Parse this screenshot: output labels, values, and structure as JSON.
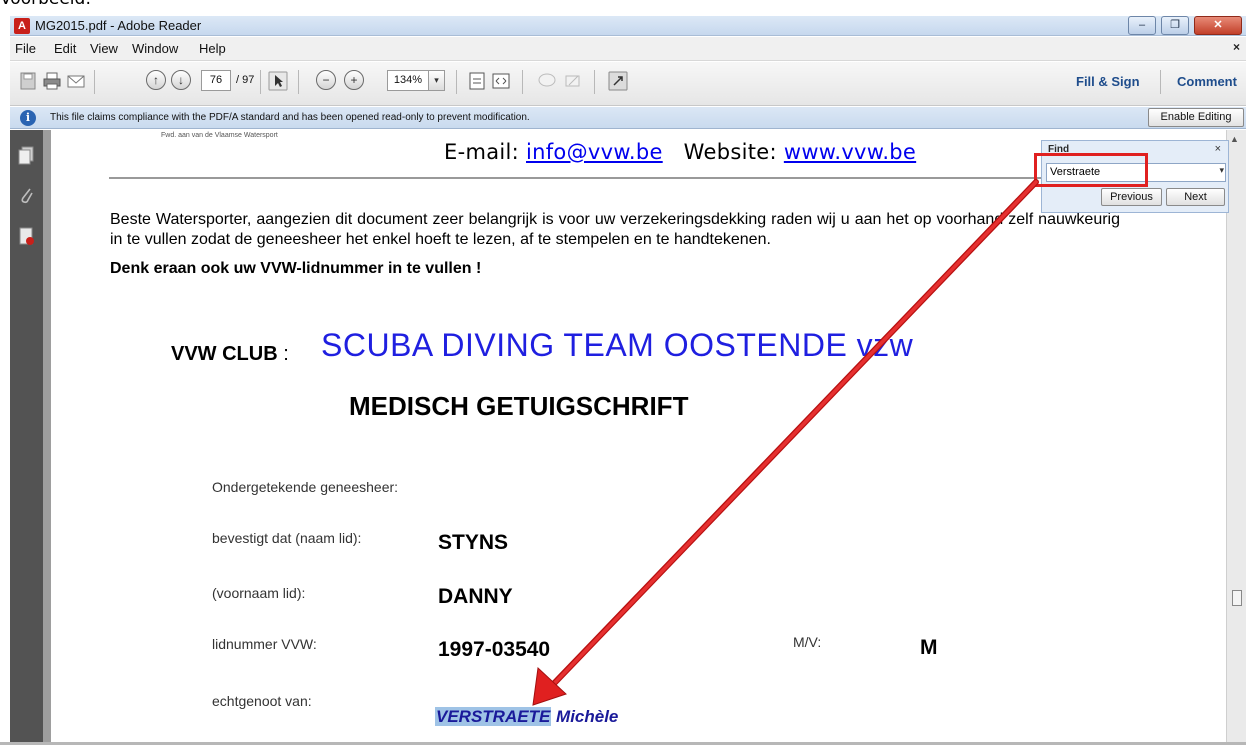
{
  "caption": "Voorbeeld:",
  "window": {
    "title": "MG2015.pdf - Adobe Reader",
    "app_icon": "adobe-reader-icon",
    "min_glyph": "‒",
    "max_glyph": "❐",
    "close_glyph": "✕"
  },
  "menu": {
    "items": [
      "File",
      "Edit",
      "View",
      "Window",
      "Help"
    ],
    "close_glyph": "×"
  },
  "toolbar": {
    "page_current": "76",
    "page_total": "/ 97",
    "zoom": "134%",
    "zoom_out_glyph": "−",
    "zoom_in_glyph": "+",
    "prev_glyph": "↑",
    "next_glyph": "↓",
    "dropdown_glyph": "▾",
    "fill_sign": "Fill & Sign",
    "comment": "Comment"
  },
  "infobar": {
    "icon_glyph": "i",
    "message": "This file claims compliance with the PDF/A standard and has been opened read-only to prevent modification.",
    "enable_editing": "Enable Editing"
  },
  "find": {
    "title": "Find",
    "close_glyph": "×",
    "query": "Verstraete",
    "dropdown_glyph": "▾",
    "previous": "Previous",
    "next": "Next"
  },
  "document": {
    "faint_header": "Fwd. aan van de Vlaamse Watersport",
    "email_label": "E-mail:",
    "email": "info@vvw.be",
    "website_label": "Website:",
    "website": "www.vvw.be",
    "intro": "Beste Watersporter, aangezien dit document zeer belangrijk is voor uw verzekeringsdekking raden wij u aan het op voorhand zelf nauwkeurig in te vullen zodat de geneesheer het enkel hoeft te lezen, af te stempelen en te handtekenen.",
    "intro_bold": "Denk eraan ook uw VVW-lidnummer in te vullen !",
    "club_label": "VVW CLUB",
    "club_sep": ":",
    "club_name": "SCUBA DIVING TEAM OOSTENDE vzw",
    "title": "MEDISCH GETUIGSCHRIFT",
    "fields": {
      "doctor_label": "Ondergetekende geneesheer:",
      "surname_label": "bevestigt dat (naam lid):",
      "surname_value": "STYNS",
      "firstname_label": "(voornaam lid):",
      "firstname_value": "DANNY",
      "member_label": "lidnummer VVW:",
      "member_value": "1997-03540",
      "gender_label": "M/V:",
      "gender_value": "M",
      "spouse_label": "echtgenoot van:",
      "spouse_highlight": "VERSTRAETE",
      "spouse_rest": "Michèle"
    }
  },
  "colors": {
    "annotation": "#e02020",
    "highlight": "#9fc3e6",
    "club_blue": "#1f1fe0",
    "link": "#0000ee"
  }
}
